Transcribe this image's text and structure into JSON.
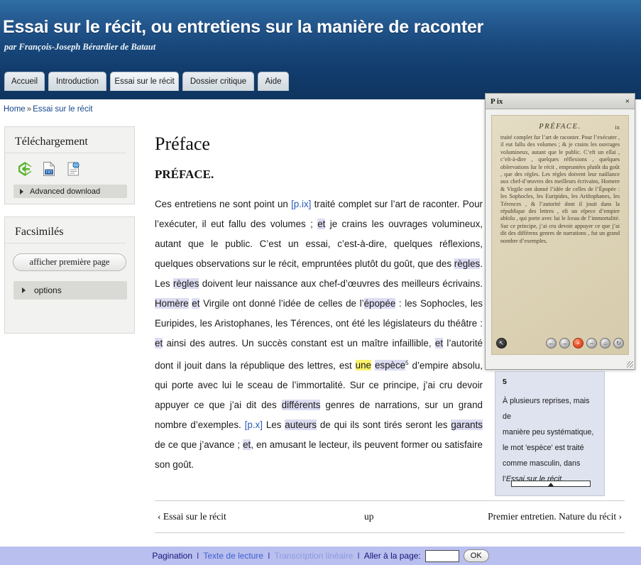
{
  "header": {
    "title": "Essai sur le récit, ou entretiens sur la manière de raconter",
    "subtitle": "par François-Joseph Bérardier de Bataut"
  },
  "tabs": [
    {
      "label": "Accueil",
      "active": false
    },
    {
      "label": "Introduction",
      "active": false
    },
    {
      "label": "Essai sur le récit",
      "active": true
    },
    {
      "label": "Dossier critique",
      "active": false
    },
    {
      "label": "Aide",
      "active": false
    }
  ],
  "breadcrumb": {
    "home": "Home",
    "separator": "»",
    "current": "Essai sur le récit"
  },
  "sidebar": {
    "download": {
      "title": "Téléchargement",
      "icons": [
        "epub-icon",
        "txt-file-icon",
        "html-page-icon"
      ],
      "advanced_label": "Advanced download"
    },
    "facsimiles": {
      "title": "Facsimilés",
      "button_label": "afficher première page",
      "options_label": "options"
    }
  },
  "main": {
    "page_title": "Préface",
    "section_title": "PRÉFACE.",
    "paragraph": {
      "s1": "Ces entretiens ne sont point un ",
      "p1": "[p.ix]",
      "s2": " traité complet sur l’art de raconter. Pour l’exécuter, il eut fallu des volumes ; ",
      "h1": "et",
      "s3": " je crains les ouvrages volumineux, autant que le public. C’est un essai, c’est-à-dire, quelques réflexions, quelques observations sur le récit, empruntées plutôt du goût, que des ",
      "h2": "règles",
      "s4": ". Les ",
      "h3": "règles",
      "s5": " doivent leur naissance aux chef-d’œuvres des meilleurs écrivains. ",
      "h4": "Homère",
      "s6": " ",
      "h5": "et",
      "s7": " Virgile ont donné l’idée de celles de l’",
      "h6": "épopée",
      "s8": " : les Sophocles, les Euripides, les Aristophanes, les Térences, ont été les législateurs du théâtre : ",
      "h7": "et",
      "s9": " ainsi des autres. Un succès constant est un maître infaillible, ",
      "h8": "et",
      "s10": " l’autorité dont il jouit dans la république des lettres, est ",
      "hy": "une",
      "s11": " ",
      "h9": "espèce",
      "fn": "5",
      "s12": " d’empire absolu, qui porte avec lui le sceau de l’immortalité. Sur ce principe, j’ai cru devoir appuyer ce que j’ai dit des ",
      "h10": "différents",
      "s13": " genres de narrations, sur un grand nombre d’exemples. ",
      "p2": "[p.x]",
      "s14": " Les ",
      "h11": "auteurs",
      "s15": " de qui ils sont tirés seront les ",
      "h12": "garants",
      "s16": " de ce que j’avance ; ",
      "h13": "et",
      "s17": ", en amusant le lecteur, ils peuvent former ou satisfaire son goût."
    }
  },
  "pager": {
    "prev": "‹ Essai sur le récit",
    "up": "up",
    "next": "Premier entretien. Nature du récit ›"
  },
  "facsimile_window": {
    "title": "P ix",
    "close": "×",
    "page": {
      "heading": "PRÉFACE.",
      "folio": "ix",
      "body": "traité complet fur l’art de raconter. Pour l’exécuter , il eut fallu des volumes ; & je crains les ouvrages volumineux, autant que le public. C’eft un eſſai , c’eſt-à-dire , quelques réflexions , quelques obſervations ſur le récit , empruntées plutôt du goût , que des régles. Les régles doivent leur naiſſance aux chef-d’œuvres des meilleurs écrivains, Homere & Virgile ont donné l’idée de celles de l’Épopée : les Sophocles, les Euripides, les Ariſtophanes, les Térences , & l’autorité dont il jouit dans la république des lettres , eſt un eſpece d’empire abſolu , qui porte avec lui le ſceau de l’immortalité. Sur ce principe, j’ai cru devoir appuyer ce que j’ai dit des différens genres de narrations , fut un grand nombre d’exemples."
    },
    "tools": [
      {
        "name": "previous-page-button",
        "glyph": "←"
      },
      {
        "name": "next-page-button",
        "glyph": "→"
      },
      {
        "name": "zoom-in-button",
        "glyph": "+"
      },
      {
        "name": "zoom-out-button",
        "glyph": "–"
      },
      {
        "name": "home-button",
        "glyph": "⌂"
      },
      {
        "name": "rotate-button",
        "glyph": "↻"
      }
    ],
    "cursor_badge": "↖"
  },
  "footnote_tip": {
    "number": "5",
    "l1": "À plusieurs reprises, mais de",
    "l2": "manière peu systématique,",
    "l3": "le mot 'espèce' est traité",
    "l4": "comme masculin, dans",
    "l5_prefix": "l’",
    "l5_italic": "Essai sur le récit."
  },
  "footer": {
    "pagination": "Pagination",
    "texte": "Texte de lecture",
    "transcription": "Transcription linéaire",
    "goto_label": "Aller à la page:",
    "page_value": "",
    "ok_label": "OK",
    "separator": "I"
  },
  "colors": {
    "header_top": "#2f6ea3",
    "header_bottom": "#123d6e",
    "highlight_lavender": "#dcdcf2",
    "highlight_yellow": "#fbf36a",
    "footer_bar": "#b9bfee",
    "link_blue": "#2a5bb8"
  }
}
